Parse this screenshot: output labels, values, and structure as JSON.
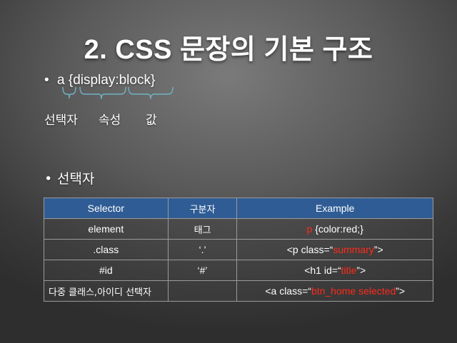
{
  "title": "2. CSS 문장의 기본 구조",
  "bullet1": {
    "marker": "•",
    "text": "a {display:block}"
  },
  "labels": {
    "selector": "선택자",
    "property": "속성",
    "value": "값"
  },
  "bullet2": {
    "marker": "•",
    "text": "선택자"
  },
  "table": {
    "headers": [
      "Selector",
      "구분자",
      "Example"
    ],
    "rows": [
      {
        "selector": "element",
        "separator": "태그",
        "ex_pre": "",
        "ex_red": "p",
        "ex_post": " {color:red;}"
      },
      {
        "selector": ".class",
        "separator": "‘.’",
        "ex_pre": "<p class=“",
        "ex_red": "summary",
        "ex_post": "”>"
      },
      {
        "selector": "#id",
        "separator": "‘#’",
        "ex_pre": "<h1 id=“",
        "ex_red": "title",
        "ex_post": "”>"
      },
      {
        "selector": "다중 클래스,아이디 선택자",
        "separator": "",
        "ex_pre": "<a class=“",
        "ex_red": "btn_home selected",
        "ex_post": "”>"
      }
    ]
  },
  "colors": {
    "header_bg": "#2f5c94",
    "highlight": "#ff2a1a",
    "brace": "#6fb3c4"
  }
}
